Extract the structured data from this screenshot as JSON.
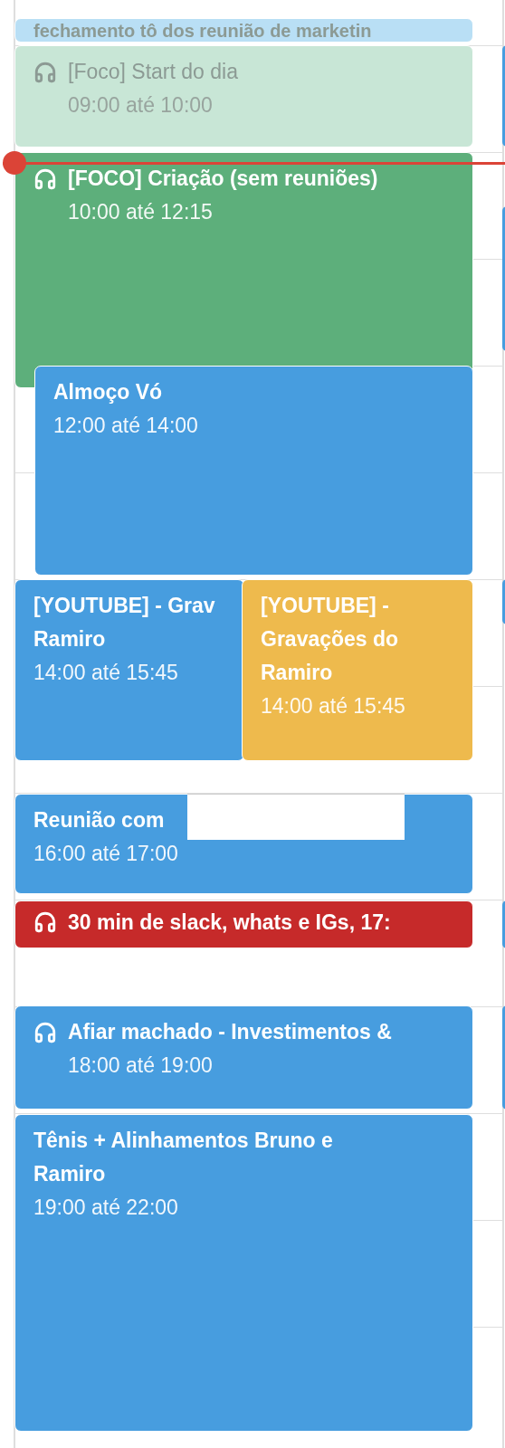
{
  "events": [
    {
      "kind": "strip",
      "title": "fechamento tô dos reunião de marketin",
      "color": "#b9dff5",
      "past": true
    },
    {
      "kind": "focus",
      "title": "[Foco] Start do dia",
      "time": "09:00 até 10:00",
      "color": "#c8e6d6",
      "past": true
    },
    {
      "kind": "focus",
      "title": "[FOCO] Criação (sem reuniões)",
      "time": "10:00 até 12:15",
      "color": "#5daf7b",
      "past": false
    },
    {
      "kind": "timed",
      "title": "Almoço Vó",
      "time": "12:00 até 14:00",
      "color": "#479ddf",
      "past": false
    },
    {
      "kind": "timed",
      "title": "[YOUTUBE] - Grav\nRamiro",
      "time": "14:00 até 15:45",
      "color": "#479ddf",
      "past": false
    },
    {
      "kind": "timed",
      "title": "[YOUTUBE] - Gravações do Ramiro",
      "time": "14:00 até 15:45",
      "color": "#eeba4d",
      "past": false
    },
    {
      "kind": "timed",
      "title": "Reunião com",
      "time": "16:00 até 17:00",
      "color": "#479ddf",
      "past": false
    },
    {
      "kind": "focus_strip",
      "title": "30 min de slack, whats e IGs, 17:",
      "color": "#c62a2a",
      "past": false
    },
    {
      "kind": "focus",
      "title": "Afiar machado - Investimentos &",
      "time": "18:00 até 19:00",
      "color": "#479ddf",
      "past": false
    },
    {
      "kind": "timed",
      "title": "Tênis + Alinhamentos Bruno e Ramiro",
      "time": "19:00 até 22:00",
      "color": "#479ddf",
      "past": false
    }
  ]
}
